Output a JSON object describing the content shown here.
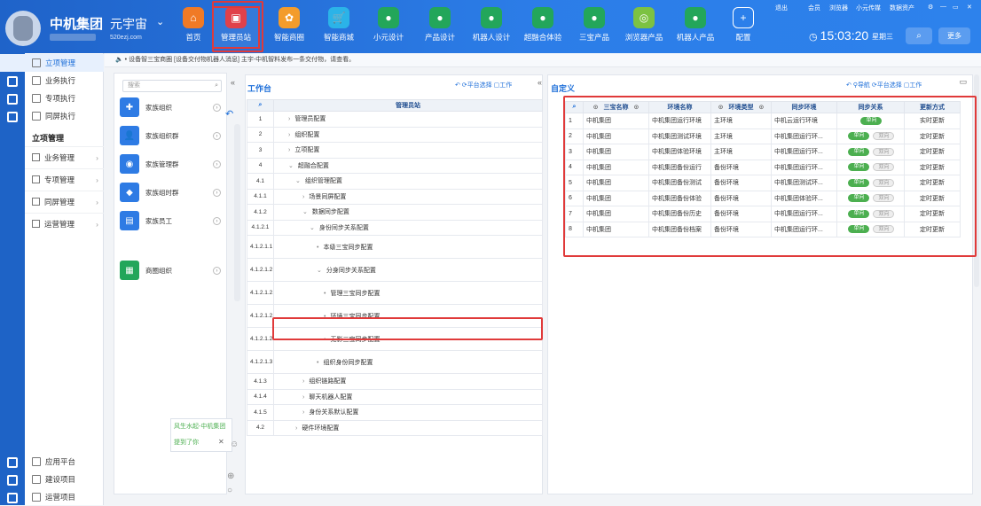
{
  "header": {
    "company": "中机集团",
    "universe": "元宇宙",
    "domain": "520ezj.com",
    "clock": "15:03:20",
    "weekday": "星期三",
    "more": "更多"
  },
  "top_links": [
    "退出",
    "会员",
    "浏览器",
    "小元传媒",
    "数据资产"
  ],
  "nav": [
    {
      "label": "首页",
      "color": "#f07a26",
      "glyph": "⌂"
    },
    {
      "label": "管理员站",
      "color": "#e0414a",
      "glyph": "▣",
      "active": true
    },
    {
      "label": "智能商圈",
      "color": "#f39c2b",
      "glyph": "✿"
    },
    {
      "label": "智能商城",
      "color": "#2bb3e8",
      "glyph": "🛒"
    },
    {
      "label": "小元设计",
      "color": "#23a65a",
      "glyph": "●"
    },
    {
      "label": "产品设计",
      "color": "#23a65a",
      "glyph": "●"
    },
    {
      "label": "机器人设计",
      "color": "#23a65a",
      "glyph": "●"
    },
    {
      "label": "超融合体验",
      "color": "#23a65a",
      "glyph": "●"
    },
    {
      "label": "三宝产品",
      "color": "#23a65a",
      "glyph": "●"
    },
    {
      "label": "浏览器产品",
      "color": "#7cc242",
      "glyph": "◎"
    },
    {
      "label": "机器人产品",
      "color": "#23a65a",
      "glyph": "●"
    },
    {
      "label": "配置",
      "color": "#4f8ee6",
      "glyph": "+"
    }
  ],
  "notice": "• 设备智三宝商圈 [设备交付物机器人消息] 主宇-中机智料发布一条交付物，请查看。",
  "sidebar": {
    "top_items": [
      "立项管理",
      "业务执行",
      "专项执行",
      "同屏执行"
    ],
    "section_title": "立项管理",
    "groups": [
      "业务管理",
      "专项管理",
      "同屏管理",
      "运营管理"
    ],
    "bottom_items": [
      "应用平台",
      "建设项目",
      "运营项目"
    ]
  },
  "org": {
    "search_placeholder": "搜索",
    "items": [
      {
        "label": "家族组织",
        "color": "#2e7be4",
        "glyph": "✚"
      },
      {
        "label": "家族组织群",
        "color": "#2e7be4",
        "glyph": "👤"
      },
      {
        "label": "家族管理群",
        "color": "#2e7be4",
        "glyph": "◉"
      },
      {
        "label": "家族组时群",
        "color": "#2e7be4",
        "glyph": "◆"
      },
      {
        "label": "家族员工",
        "color": "#2e7be4",
        "glyph": "▤"
      },
      {
        "label": "商圈组织",
        "color": "#23a65a",
        "glyph": "▦"
      }
    ],
    "chat_text": "风生水起-中机集团",
    "chat_sub": "提到了你"
  },
  "workbench": {
    "title": "工作台",
    "tool1": "平台选择",
    "tool2": "工作",
    "header": "管理员站",
    "rows": [
      {
        "no": "1",
        "label": "管理员配置",
        "indent": 1
      },
      {
        "no": "2",
        "label": "组织配置",
        "indent": 1
      },
      {
        "no": "3",
        "label": "立项配置",
        "indent": 1
      },
      {
        "no": "4",
        "label": "超融合配置",
        "indent": 1
      },
      {
        "no": "4.1",
        "label": "组织管理配置",
        "indent": 2
      },
      {
        "no": "4.1.1",
        "label": "场景同屏配置",
        "indent": 3
      },
      {
        "no": "4.1.2",
        "label": "数据同步配置",
        "indent": 3
      },
      {
        "no": "4.1.2.1",
        "label": "身份同步关系配置",
        "indent": 4
      },
      {
        "no": "4.1.2.1.1",
        "label": "本级三宝同步配置",
        "indent": 5
      },
      {
        "no": "4.1.2.1.2",
        "label": "分身同步关系配置",
        "indent": 5
      },
      {
        "no": "4.1.2.1.2.1",
        "label": "管理三宝同步配置",
        "indent": 6
      },
      {
        "no": "4.1.2.1.2.2",
        "label": "环境三宝同步配置",
        "indent": 6
      },
      {
        "no": "4.1.2.1.2.3",
        "label": "无影三宝同步配置",
        "indent": 6
      },
      {
        "no": "4.1.2.1.3",
        "label": "组织身份同步配置",
        "indent": 5
      },
      {
        "no": "4.1.3",
        "label": "组织链路配置",
        "indent": 3
      },
      {
        "no": "4.1.4",
        "label": "聊天机器人配置",
        "indent": 3
      },
      {
        "no": "4.1.5",
        "label": "身份关系默认配置",
        "indent": 3
      },
      {
        "no": "4.2",
        "label": "硬件环境配置",
        "indent": 2
      }
    ]
  },
  "custom": {
    "title": "自定义",
    "tool0": "导航",
    "tool1": "平台选择",
    "tool2": "工作",
    "columns": [
      "三宝名称",
      "环境名称",
      "环境类型",
      "同步环境",
      "同步关系",
      "更新方式"
    ],
    "rows": [
      {
        "no": "1",
        "org": "中机集团",
        "env": "中机集团运行环境",
        "type": "主环境",
        "sync": "中机云运行环境",
        "on": "单向",
        "off": "",
        "mode": "实时更新"
      },
      {
        "no": "2",
        "org": "中机集团",
        "env": "中机集团测试环境",
        "type": "主环境",
        "sync": "中机集团运行环...",
        "on": "单向",
        "off": "双向",
        "mode": "定时更新"
      },
      {
        "no": "3",
        "org": "中机集团",
        "env": "中机集团体验环境",
        "type": "主环境",
        "sync": "中机集团运行环...",
        "on": "单向",
        "off": "双向",
        "mode": "定时更新"
      },
      {
        "no": "4",
        "org": "中机集团",
        "env": "中机集团备份运行",
        "type": "备份环境",
        "sync": "中机集团运行环...",
        "on": "单向",
        "off": "双向",
        "mode": "定时更新"
      },
      {
        "no": "5",
        "org": "中机集团",
        "env": "中机集团备份测试",
        "type": "备份环境",
        "sync": "中机集团测试环...",
        "on": "单向",
        "off": "双向",
        "mode": "定时更新"
      },
      {
        "no": "6",
        "org": "中机集团",
        "env": "中机集团备份体验",
        "type": "备份环境",
        "sync": "中机集团体验环...",
        "on": "单向",
        "off": "双向",
        "mode": "定时更新"
      },
      {
        "no": "7",
        "org": "中机集团",
        "env": "中机集团备份历史",
        "type": "备份环境",
        "sync": "中机集团运行环...",
        "on": "单向",
        "off": "双向",
        "mode": "定时更新"
      },
      {
        "no": "8",
        "org": "中机集团",
        "env": "中机集团备份档案",
        "type": "备份环境",
        "sync": "中机集团运行环...",
        "on": "单向",
        "off": "双向",
        "mode": "定时更新"
      }
    ]
  },
  "colors": {
    "brand": "#1f63c9",
    "accent": "#1e6fd9",
    "highlight": "#e03a3a",
    "toggle_on": "#4caf50"
  }
}
